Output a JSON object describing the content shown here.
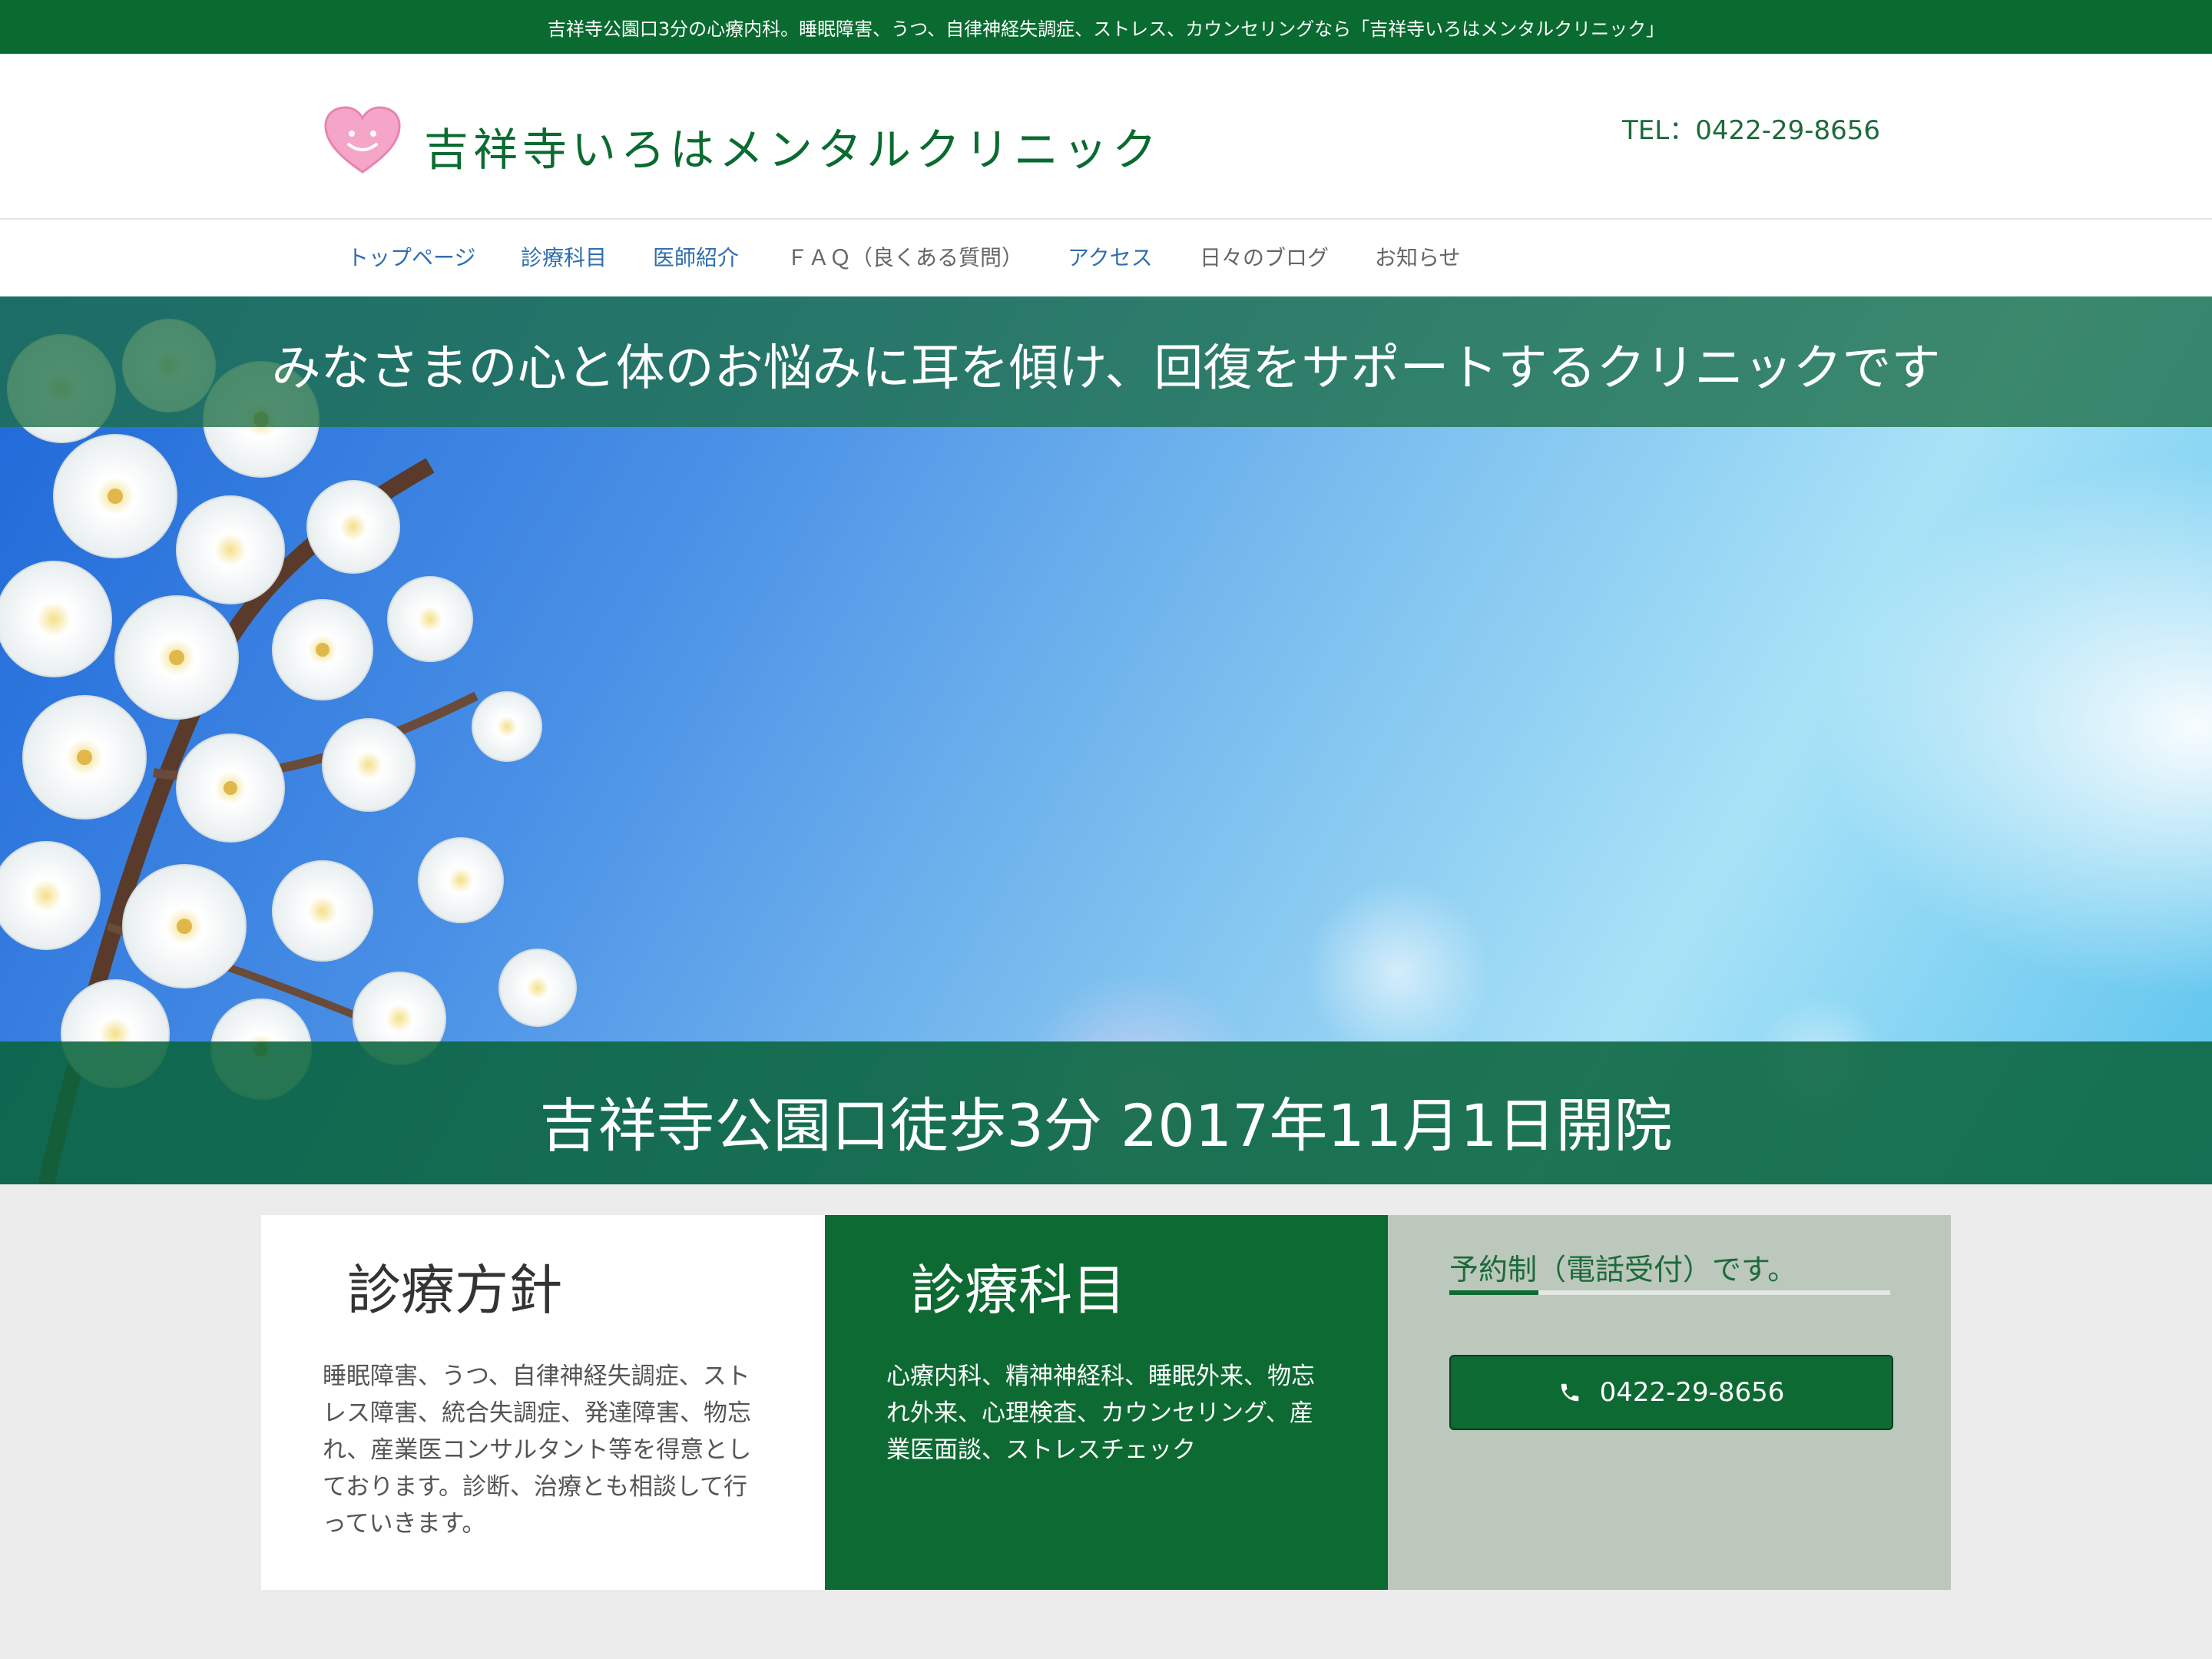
{
  "topbar": {
    "text": "吉祥寺公園口3分の心療内科。睡眠障害、うつ、自律神経失調症、ストレス、カウンセリングなら「吉祥寺いろはメンタルクリニック」"
  },
  "header": {
    "logo_text": "吉祥寺いろはメンタルクリニック",
    "logo_icon": "smiling-heart-icon",
    "tel": "TEL：0422-29-8656"
  },
  "nav": {
    "items": [
      {
        "label": "トップページ"
      },
      {
        "label": "診療科目"
      },
      {
        "label": "医師紹介"
      },
      {
        "label": "ＦＡＱ（良くある質問）"
      },
      {
        "label": "アクセス"
      },
      {
        "label": "日々のブログ"
      },
      {
        "label": "お知らせ"
      }
    ]
  },
  "hero": {
    "tagline": "みなさまの心と体のお悩みに耳を傾け、回復をサポートするクリニックです",
    "subline": "吉祥寺公園口徒歩3分 2017年11月1日開院"
  },
  "policy": {
    "title": "診療方針",
    "body": "睡眠障害、うつ、自律神経失調症、ストレス障害、統合失調症、発達障害、物忘れ、産業医コンサルタント等を得意としております。診断、治療とも相談して行っていきます。"
  },
  "departments": {
    "title": "診療科目",
    "body": "心療内科、精神神経科、睡眠外来、物忘れ外来、心理検査、カウンセリング、産業医面談、ストレスチェック"
  },
  "reservation": {
    "title": "予約制（電話受付）です。",
    "phone": "0422-29-8656",
    "phone_icon": "phone-icon"
  },
  "colors": {
    "brand_green": "#0a6b30",
    "nav_link": "#2f6fb0",
    "reservation_bg": "#bcc8bc"
  }
}
